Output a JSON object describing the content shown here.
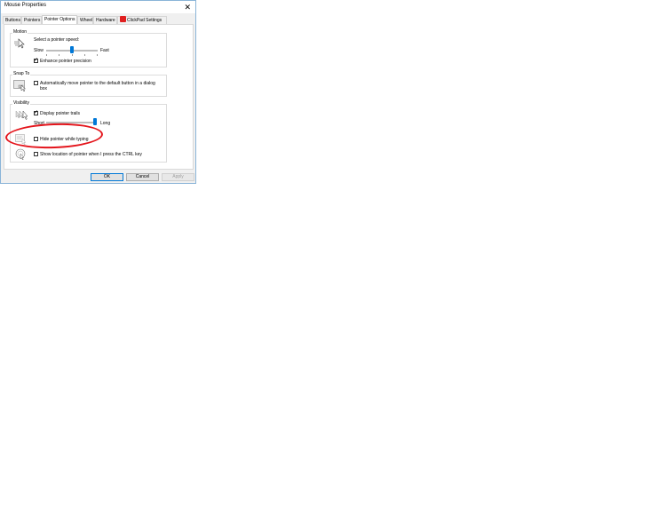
{
  "window": {
    "title": "Mouse Properties",
    "close_glyph": "✕"
  },
  "tabs": [
    {
      "label": "Buttons"
    },
    {
      "label": "Pointers"
    },
    {
      "label": "Pointer Options",
      "active": true
    },
    {
      "label": "Wheel"
    },
    {
      "label": "Hardware"
    },
    {
      "label": "ClickPad Settings",
      "icon": "clickpad-icon"
    }
  ],
  "motion": {
    "group_label": "Motion",
    "speed_label": "Select a pointer speed:",
    "slow_label": "Slow",
    "fast_label": "Fast",
    "speed_value": 0.5,
    "precision_label": "Enhance pointer precision",
    "precision_checked": true,
    "icon": "pointer-speed-icon"
  },
  "snap_to": {
    "group_label": "Snap To",
    "option_label": "Automatically move pointer to the default button in a dialog",
    "option_label_line2": "box",
    "checked": false,
    "icon": "snap-to-icon"
  },
  "visibility": {
    "group_label": "Visibility",
    "trails_label": "Display pointer trails",
    "trails_checked": true,
    "short_label": "Short",
    "long_label": "Long",
    "trails_value": 1.0,
    "hide_label": "Hide pointer while typing",
    "hide_checked": false,
    "ctrl_label": "Show location of pointer when I press the CTRL key",
    "ctrl_checked": false,
    "icons": [
      "pointer-trails-icon",
      "hide-pointer-icon",
      "show-location-icon"
    ]
  },
  "buttons": {
    "ok": "OK",
    "cancel": "Cancel",
    "apply": "Apply",
    "apply_disabled": true
  },
  "colors": {
    "highlight": "#e4141b",
    "accent": "#0078d7"
  }
}
